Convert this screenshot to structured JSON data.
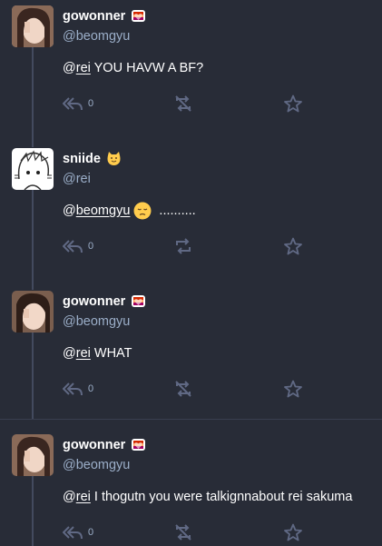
{
  "statuses": [
    {
      "display_name": "gowonner",
      "handle": "@beomgyu",
      "mention_at": "@",
      "mention_user": "rei",
      "text": " YOU HAVW A BF?",
      "reply_count": "0",
      "name_emoji": "pride-heart-emoji"
    },
    {
      "display_name": "sniide",
      "handle": "@rei",
      "mention_at": "@",
      "mention_user": "beomgyu",
      "text": " ..........",
      "reply_count": "0",
      "name_emoji": "cat-emoji",
      "content_emoji": "disappointed-face-emoji"
    },
    {
      "display_name": "gowonner",
      "handle": "@beomgyu",
      "mention_at": "@",
      "mention_user": "rei",
      "text": " WHAT",
      "reply_count": "0",
      "name_emoji": "pride-heart-emoji"
    },
    {
      "display_name": "gowonner",
      "handle": "@beomgyu",
      "mention_at": "@",
      "mention_user": "rei",
      "text": " I thogutn you were talkignnabout rei sakuma",
      "reply_count": "0",
      "name_emoji": "pride-heart-emoji"
    }
  ],
  "colors": {
    "background": "#282c37",
    "secondary_text": "#9baec8",
    "icon": "#606984"
  }
}
